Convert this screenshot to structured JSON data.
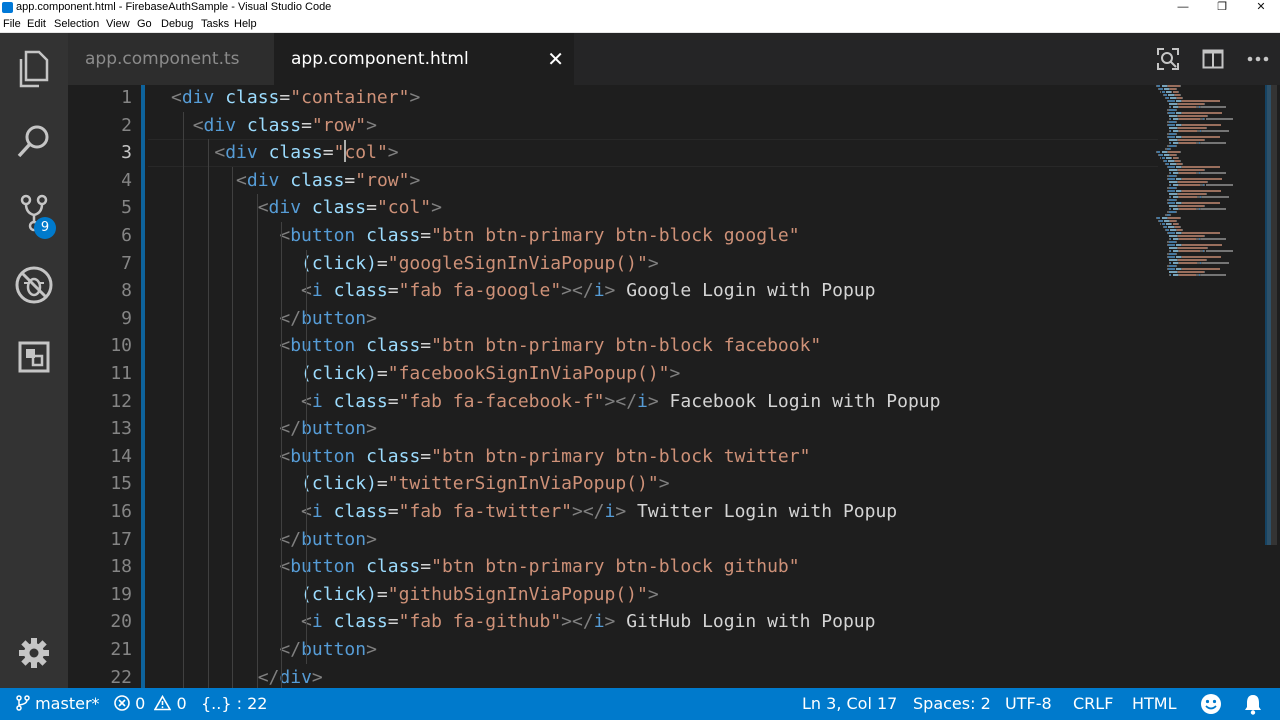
{
  "window": {
    "title": "app.component.html - FirebaseAuthSample - Visual Studio Code",
    "controls": {
      "minimize": "—",
      "restore": "❐",
      "close": "✕"
    }
  },
  "menu": [
    "File",
    "Edit",
    "Selection",
    "View",
    "Go",
    "Debug",
    "Tasks",
    "Help"
  ],
  "activity_bar": {
    "items": [
      {
        "name": "explorer",
        "icon": "files-icon"
      },
      {
        "name": "search",
        "icon": "search-icon"
      },
      {
        "name": "source-control",
        "icon": "git-branch-icon",
        "badge": "9"
      },
      {
        "name": "debug",
        "icon": "no-bug-icon"
      },
      {
        "name": "extensions",
        "icon": "extensions-icon"
      }
    ],
    "settings_icon": "gear-icon"
  },
  "tabs": [
    {
      "label": "app.component.ts",
      "active": false
    },
    {
      "label": "app.component.html",
      "active": true,
      "close": "✕"
    }
  ],
  "editor": {
    "current_line": 3,
    "line_numbers": [
      "1",
      "2",
      "3",
      "4",
      "5",
      "6",
      "7",
      "8",
      "9",
      "10",
      "11",
      "12",
      "13",
      "14",
      "15",
      "16",
      "17",
      "18",
      "19",
      "20",
      "21",
      "22"
    ],
    "lines": [
      [
        [
          "p",
          "<"
        ],
        [
          "t",
          "div"
        ],
        [
          "x",
          " "
        ],
        [
          "a",
          "class"
        ],
        [
          "x",
          "="
        ],
        [
          "s",
          "\"container\""
        ],
        [
          "p",
          ">"
        ]
      ],
      [
        [
          "x",
          "  "
        ],
        [
          "p",
          "<"
        ],
        [
          "t",
          "div"
        ],
        [
          "x",
          " "
        ],
        [
          "a",
          "class"
        ],
        [
          "x",
          "="
        ],
        [
          "s",
          "\"row\""
        ],
        [
          "p",
          ">"
        ]
      ],
      [
        [
          "x",
          "    "
        ],
        [
          "p",
          "<"
        ],
        [
          "t",
          "div"
        ],
        [
          "x",
          " "
        ],
        [
          "a",
          "class"
        ],
        [
          "x",
          "="
        ],
        [
          "s",
          "\""
        ],
        [
          "cursor",
          ""
        ],
        [
          "s",
          "col\""
        ],
        [
          "p",
          ">"
        ]
      ],
      [
        [
          "x",
          "      "
        ],
        [
          "p",
          "<"
        ],
        [
          "t",
          "div"
        ],
        [
          "x",
          " "
        ],
        [
          "a",
          "class"
        ],
        [
          "x",
          "="
        ],
        [
          "s",
          "\"row\""
        ],
        [
          "p",
          ">"
        ]
      ],
      [
        [
          "x",
          "        "
        ],
        [
          "p",
          "<"
        ],
        [
          "t",
          "div"
        ],
        [
          "x",
          " "
        ],
        [
          "a",
          "class"
        ],
        [
          "x",
          "="
        ],
        [
          "s",
          "\"col\""
        ],
        [
          "p",
          ">"
        ]
      ],
      [
        [
          "x",
          "          "
        ],
        [
          "p",
          "<"
        ],
        [
          "t",
          "button"
        ],
        [
          "x",
          " "
        ],
        [
          "a",
          "class"
        ],
        [
          "x",
          "="
        ],
        [
          "s",
          "\"btn btn-primary btn-block google\""
        ]
      ],
      [
        [
          "x",
          "            "
        ],
        [
          "a",
          "(click)"
        ],
        [
          "x",
          "="
        ],
        [
          "s",
          "\"googleSignInViaPopup()\""
        ],
        [
          "p",
          ">"
        ]
      ],
      [
        [
          "x",
          "            "
        ],
        [
          "p",
          "<"
        ],
        [
          "t",
          "i"
        ],
        [
          "x",
          " "
        ],
        [
          "a",
          "class"
        ],
        [
          "x",
          "="
        ],
        [
          "s",
          "\"fab fa-google\""
        ],
        [
          "p",
          "></"
        ],
        [
          "t",
          "i"
        ],
        [
          "p",
          ">"
        ],
        [
          "x",
          " Google Login with Popup"
        ]
      ],
      [
        [
          "x",
          "          "
        ],
        [
          "p",
          "</"
        ],
        [
          "t",
          "button"
        ],
        [
          "p",
          ">"
        ]
      ],
      [
        [
          "x",
          "          "
        ],
        [
          "p",
          "<"
        ],
        [
          "t",
          "button"
        ],
        [
          "x",
          " "
        ],
        [
          "a",
          "class"
        ],
        [
          "x",
          "="
        ],
        [
          "s",
          "\"btn btn-primary btn-block facebook\""
        ]
      ],
      [
        [
          "x",
          "            "
        ],
        [
          "a",
          "(click)"
        ],
        [
          "x",
          "="
        ],
        [
          "s",
          "\"facebookSignInViaPopup()\""
        ],
        [
          "p",
          ">"
        ]
      ],
      [
        [
          "x",
          "            "
        ],
        [
          "p",
          "<"
        ],
        [
          "t",
          "i"
        ],
        [
          "x",
          " "
        ],
        [
          "a",
          "class"
        ],
        [
          "x",
          "="
        ],
        [
          "s",
          "\"fab fa-facebook-f\""
        ],
        [
          "p",
          "></"
        ],
        [
          "t",
          "i"
        ],
        [
          "p",
          ">"
        ],
        [
          "x",
          " Facebook Login with Popup"
        ]
      ],
      [
        [
          "x",
          "          "
        ],
        [
          "p",
          "</"
        ],
        [
          "t",
          "button"
        ],
        [
          "p",
          ">"
        ]
      ],
      [
        [
          "x",
          "          "
        ],
        [
          "p",
          "<"
        ],
        [
          "t",
          "button"
        ],
        [
          "x",
          " "
        ],
        [
          "a",
          "class"
        ],
        [
          "x",
          "="
        ],
        [
          "s",
          "\"btn btn-primary btn-block twitter\""
        ]
      ],
      [
        [
          "x",
          "            "
        ],
        [
          "a",
          "(click)"
        ],
        [
          "x",
          "="
        ],
        [
          "s",
          "\"twitterSignInViaPopup()\""
        ],
        [
          "p",
          ">"
        ]
      ],
      [
        [
          "x",
          "            "
        ],
        [
          "p",
          "<"
        ],
        [
          "t",
          "i"
        ],
        [
          "x",
          " "
        ],
        [
          "a",
          "class"
        ],
        [
          "x",
          "="
        ],
        [
          "s",
          "\"fab fa-twitter\""
        ],
        [
          "p",
          "></"
        ],
        [
          "t",
          "i"
        ],
        [
          "p",
          ">"
        ],
        [
          "x",
          " Twitter Login with Popup"
        ]
      ],
      [
        [
          "x",
          "          "
        ],
        [
          "p",
          "</"
        ],
        [
          "t",
          "button"
        ],
        [
          "p",
          ">"
        ]
      ],
      [
        [
          "x",
          "          "
        ],
        [
          "p",
          "<"
        ],
        [
          "t",
          "button"
        ],
        [
          "x",
          " "
        ],
        [
          "a",
          "class"
        ],
        [
          "x",
          "="
        ],
        [
          "s",
          "\"btn btn-primary btn-block github\""
        ]
      ],
      [
        [
          "x",
          "            "
        ],
        [
          "a",
          "(click)"
        ],
        [
          "x",
          "="
        ],
        [
          "s",
          "\"githubSignInViaPopup()\""
        ],
        [
          "p",
          ">"
        ]
      ],
      [
        [
          "x",
          "            "
        ],
        [
          "p",
          "<"
        ],
        [
          "t",
          "i"
        ],
        [
          "x",
          " "
        ],
        [
          "a",
          "class"
        ],
        [
          "x",
          "="
        ],
        [
          "s",
          "\"fab fa-github\""
        ],
        [
          "p",
          "></"
        ],
        [
          "t",
          "i"
        ],
        [
          "p",
          ">"
        ],
        [
          "x",
          " GitHub Login with Popup"
        ]
      ],
      [
        [
          "x",
          "          "
        ],
        [
          "p",
          "</"
        ],
        [
          "t",
          "button"
        ],
        [
          "p",
          ">"
        ]
      ],
      [
        [
          "x",
          "        "
        ],
        [
          "p",
          "</"
        ],
        [
          "t",
          "div"
        ],
        [
          "p",
          ">"
        ]
      ]
    ]
  },
  "statusbar": {
    "branch": "master*",
    "errors": "0",
    "warnings": "0",
    "braces": "{..} : 22",
    "position": "Ln 3, Col 17",
    "spaces": "Spaces: 2",
    "encoding": "UTF-8",
    "eol": "CRLF",
    "language": "HTML"
  },
  "colors": {
    "accent": "#007acc",
    "tag": "#569cd6",
    "attribute": "#9cdcfe",
    "string": "#ce9178",
    "punctuation": "#808080"
  }
}
